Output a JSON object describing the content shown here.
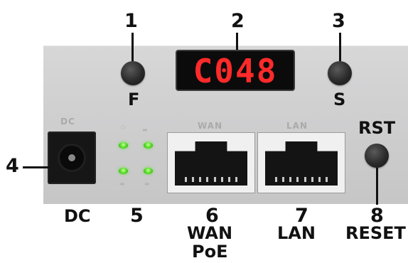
{
  "callouts": [
    {
      "num": "1",
      "label": "F"
    },
    {
      "num": "2",
      "label": ""
    },
    {
      "num": "3",
      "label": "S"
    },
    {
      "num": "4",
      "label": "DC"
    },
    {
      "num": "5",
      "label": ""
    },
    {
      "num": "6",
      "label": "WAN",
      "label2": "PoE"
    },
    {
      "num": "7",
      "label": "LAN"
    },
    {
      "num": "8",
      "label": "RESET",
      "top_label": "RST"
    }
  ],
  "display": {
    "text": "C048",
    "color": "#ff2a2a"
  },
  "silkscreen": {
    "dc": "DC",
    "wan": "WAN",
    "lan": "LAN"
  },
  "led_color": "#5ee12f"
}
